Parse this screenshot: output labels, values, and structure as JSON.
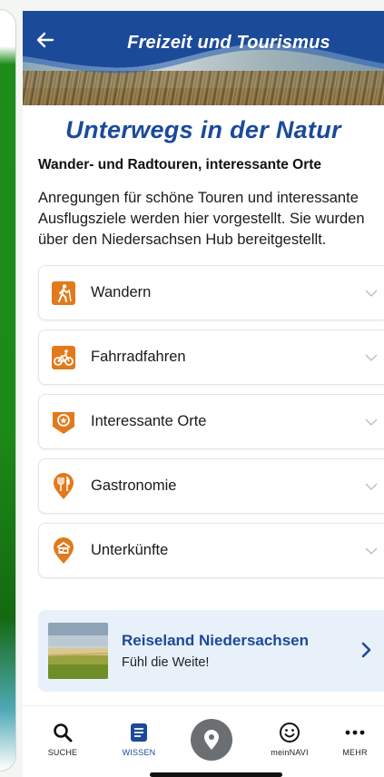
{
  "header": {
    "title": "Freizeit und Tourismus",
    "back_icon": "arrow-left-icon"
  },
  "page": {
    "title": "Unterwegs in der Natur",
    "subtitle": "Wander- und Radtouren, interessante Orte",
    "intro": "Anregungen für schöne Touren und interessante Ausflugsziele werden hier vorgestellt. Sie wurden über den Niedersachsen Hub bereitgestellt."
  },
  "categories": [
    {
      "label": "Wandern",
      "icon": "hiking-icon"
    },
    {
      "label": "Fahrradfahren",
      "icon": "bicycle-icon"
    },
    {
      "label": "Interessante Orte",
      "icon": "map-star-icon"
    },
    {
      "label": "Gastronomie",
      "icon": "restaurant-pin-icon"
    },
    {
      "label": "Unterkünfte",
      "icon": "accommodation-pin-icon"
    }
  ],
  "promo": {
    "title": "Reiseland Niedersachsen",
    "subtitle": "Fühl die Weite!"
  },
  "tabbar": {
    "tabs": [
      {
        "label": "SUCHE",
        "icon": "search-icon"
      },
      {
        "label": "WISSEN",
        "icon": "document-icon"
      },
      {
        "label": "",
        "icon": "location-pin-icon"
      },
      {
        "label": "meinNAVI",
        "icon": "smiley-icon"
      },
      {
        "label": "MEHR",
        "icon": "more-dots-icon"
      }
    ],
    "active": "WISSEN"
  },
  "colors": {
    "brand_blue": "#1b4a99",
    "icon_orange": "#e27a1c",
    "promo_bg": "#e8f1fa"
  }
}
